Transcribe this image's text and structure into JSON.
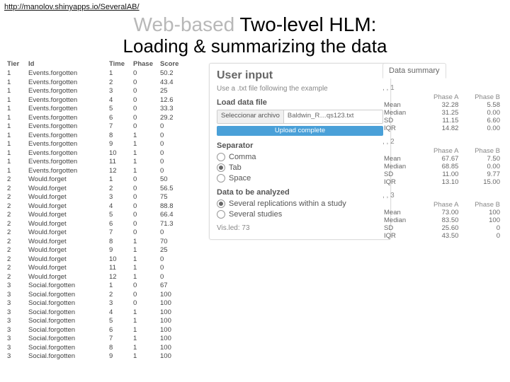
{
  "url": "http://manolov.shinyapps.io/SeveralAB/",
  "title": {
    "a": "Web-based ",
    "b": "Two-level HLM:",
    "sub": "Loading & summarizing the data"
  },
  "dt": {
    "head": [
      "Tier",
      "Id",
      "Time",
      "Phase",
      "Score"
    ],
    "rows": [
      [
        "1",
        "Events.forgotten",
        "1",
        "0",
        "50.2"
      ],
      [
        "1",
        "Events.forgotten",
        "2",
        "0",
        "43.4"
      ],
      [
        "1",
        "Events.forgotten",
        "3",
        "0",
        "25"
      ],
      [
        "1",
        "Events.forgotten",
        "4",
        "0",
        "12.6"
      ],
      [
        "1",
        "Events.forgotten",
        "5",
        "0",
        "33.3"
      ],
      [
        "1",
        "Events.forgotten",
        "6",
        "0",
        "29.2"
      ],
      [
        "1",
        "Events.forgotten",
        "7",
        "0",
        "0"
      ],
      [
        "1",
        "Events.forgotten",
        "8",
        "1",
        "0"
      ],
      [
        "1",
        "Events.forgotten",
        "9",
        "1",
        "0"
      ],
      [
        "1",
        "Events.forgotten",
        "10",
        "1",
        "0"
      ],
      [
        "1",
        "Events.forgotten",
        "11",
        "1",
        "0"
      ],
      [
        "1",
        "Events.forgotten",
        "12",
        "1",
        "0"
      ],
      [
        "2",
        "Would.forget",
        "1",
        "0",
        "50"
      ],
      [
        "2",
        "Would.forget",
        "2",
        "0",
        "56.5"
      ],
      [
        "2",
        "Would.forget",
        "3",
        "0",
        "75"
      ],
      [
        "2",
        "Would.forget",
        "4",
        "0",
        "88.8"
      ],
      [
        "2",
        "Would.forget",
        "5",
        "0",
        "66.4"
      ],
      [
        "2",
        "Would.forget",
        "6",
        "0",
        "71.3"
      ],
      [
        "2",
        "Would.forget",
        "7",
        "0",
        "0"
      ],
      [
        "2",
        "Would.forget",
        "8",
        "1",
        "70"
      ],
      [
        "2",
        "Would.forget",
        "9",
        "1",
        "25"
      ],
      [
        "2",
        "Would.forget",
        "10",
        "1",
        "0"
      ],
      [
        "2",
        "Would.forget",
        "11",
        "1",
        "0"
      ],
      [
        "2",
        "Would.forget",
        "12",
        "1",
        "0"
      ],
      [
        "3",
        "Social.forgotten",
        "1",
        "0",
        "67"
      ],
      [
        "3",
        "Social.forgotten",
        "2",
        "0",
        "100"
      ],
      [
        "3",
        "Social.forgotten",
        "3",
        "0",
        "100"
      ],
      [
        "3",
        "Social.forgotten",
        "4",
        "1",
        "100"
      ],
      [
        "3",
        "Social.forgotten",
        "5",
        "1",
        "100"
      ],
      [
        "3",
        "Social.forgotten",
        "6",
        "1",
        "100"
      ],
      [
        "3",
        "Social.forgotten",
        "7",
        "1",
        "100"
      ],
      [
        "3",
        "Social.forgotten",
        "8",
        "1",
        "100"
      ],
      [
        "3",
        "Social.forgotten",
        "9",
        "1",
        "100"
      ]
    ]
  },
  "panel": {
    "heading": "User input",
    "hint": "Use a .txt file following the example",
    "load_lbl": "Load data file",
    "choose_btn": "Seleccionar archivo",
    "filename": "Baldwin_R…qs123.txt",
    "upload_msg": "Upload complete",
    "sep_lbl": "Separator",
    "sep_opts": [
      {
        "l": "Comma",
        "on": false
      },
      {
        "l": "Tab",
        "on": true
      },
      {
        "l": "Space",
        "on": false
      }
    ],
    "analyze_lbl": "Data to be analyzed",
    "analyze_opts": [
      {
        "l": "Several replications within a study",
        "on": true
      },
      {
        "l": "Several studies",
        "on": false
      }
    ],
    "vis": "Vis.led: 73"
  },
  "summary": {
    "tab": "Data summary",
    "groups": [
      {
        "h": ", , 1",
        "cols": [
          "",
          "Phase A",
          "Phase B"
        ],
        "rows": [
          [
            "Mean",
            "32.28",
            "5.58"
          ],
          [
            "Median",
            "31.25",
            "0.00"
          ],
          [
            "SD",
            "11.15",
            "6.60"
          ],
          [
            "IQR",
            "14.82",
            "0.00"
          ]
        ]
      },
      {
        "h": ", , 2",
        "cols": [
          "",
          "Phase A",
          "Phase B"
        ],
        "rows": [
          [
            "Mean",
            "67.67",
            "7.50"
          ],
          [
            "Median",
            "68.85",
            "0.00"
          ],
          [
            "SD",
            "11.00",
            "9.77"
          ],
          [
            "IQR",
            "13.10",
            "15.00"
          ]
        ]
      },
      {
        "h": ", , 3",
        "cols": [
          "",
          "Phase A",
          "Phase B"
        ],
        "rows": [
          [
            "Mean",
            "73.00",
            "100"
          ],
          [
            "Median",
            "83.50",
            "100"
          ],
          [
            "SD",
            "25.60",
            "0"
          ],
          [
            "IQR",
            "43.50",
            "0"
          ]
        ]
      }
    ]
  }
}
